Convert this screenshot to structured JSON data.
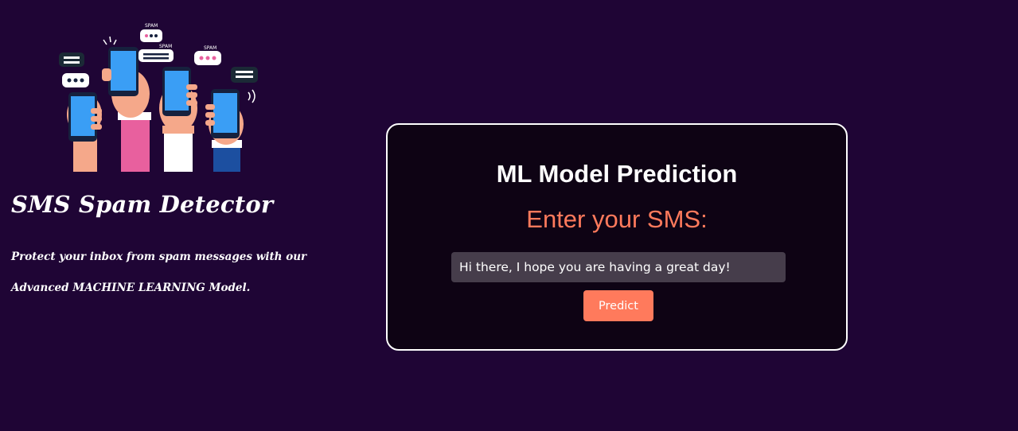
{
  "sidebar": {
    "illustration": {
      "icon": "hands-holding-phones-with-spam-bubbles-illustration",
      "bubble_labels": [
        "SPAM",
        "SPAM",
        "SPAM"
      ]
    },
    "title": "SMS Spam Detector",
    "tagline_line1": "Protect your inbox from spam messages with our",
    "tagline_line2": "Advanced MACHINE LEARNING Model."
  },
  "card": {
    "title": "ML Model Prediction",
    "subtitle": "Enter your SMS:",
    "sms_input": {
      "value": "Hi there, I hope you are having a great day!",
      "placeholder": ""
    },
    "predict_label": "Predict"
  },
  "colors": {
    "background": "#1f0535",
    "card_background": "#0e0314",
    "accent": "#ff7a5c",
    "input_background": "#463d4b",
    "phone_screen": "#3a9ef5",
    "skin": "#f5a88a"
  }
}
